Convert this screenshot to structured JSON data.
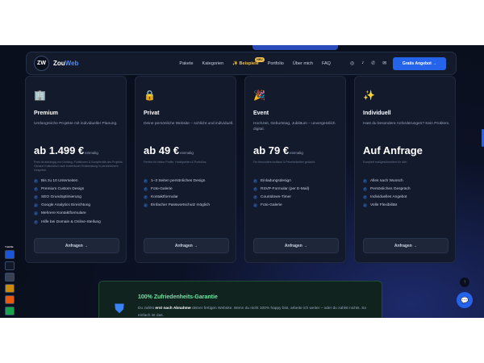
{
  "nav": {
    "logo_text": "ZW",
    "brand_main": "Zou",
    "brand_accent": "Web",
    "links": [
      {
        "label": "Pakete"
      },
      {
        "label": "Kategorien"
      },
      {
        "label": "✨ Beispiele",
        "badge": "NEU"
      },
      {
        "label": "Portfolio"
      },
      {
        "label": "Über mich"
      },
      {
        "label": "FAQ"
      }
    ],
    "icons": [
      "instagram-icon",
      "tiktok-icon",
      "whatsapp-icon",
      "mail-icon"
    ],
    "cta_label": "Gratis Angebot →"
  },
  "cards": [
    {
      "icon": "🏢",
      "title": "Premium",
      "desc": "Umfangreiche Projekte mit individueller Planung.",
      "price": "ab 1.499 €",
      "price_suffix": "einmalig",
      "note": "Preis ist abhängig von Umfang, Funktionen & Komplexität des Projekts. Genaue Kalkulation nach kostenloser Erstberatung in persönlichem Gespräch.",
      "features": [
        "Bis zu 10 Unterseiten",
        "Premium Custom Design",
        "SEO Grundoptimierung",
        "Google Analytics Einrichtung",
        "Mehrere Kontaktformulare",
        "Hilfe bei Domain & Online-Stellung"
      ],
      "button": "Anfragen →"
    },
    {
      "icon": "🔒",
      "title": "Privat",
      "desc": "Deine persönliche Website – schlicht und individuell.",
      "price": "ab 49 €",
      "price_suffix": "einmalig",
      "note": "Perfekt für kleine Profile, Hobbyseiten & Portfolios.",
      "features": [
        "1–3 Seiten persönliches Design",
        "Foto-Galerie",
        "Kontaktformular",
        "Einfacher Passwortschutz möglich"
      ],
      "button": "Anfragen →"
    },
    {
      "icon": "🎉",
      "title": "Event",
      "desc": "Hochzeit, Geburtstag, Jubiläum – unvergesslich digital.",
      "price": "ab 79 €",
      "price_suffix": "einmalig",
      "note": "Für besondere Anlässe & Feierlichkeiten gedacht.",
      "features": [
        "Einladungsdesign",
        "RSVP-Formular (per E-Mail)",
        "Countdown-Timer",
        "Foto-Galerie"
      ],
      "button": "Anfragen →"
    },
    {
      "icon": "✨",
      "title": "Individuell",
      "desc": "Hast du besondere Anforderungen? Kein Problem.",
      "price": "Auf Anfrage",
      "price_suffix": "",
      "note": "Komplett maßgeschneidert für dich.",
      "features": [
        "Alles nach Wunsch",
        "Persönliches Gespräch",
        "Individuelles Angebot",
        "Volle Flexibilität"
      ],
      "button": "Anfragen →"
    }
  ],
  "themes": {
    "label": "THEME",
    "swatches": [
      "#1a56db",
      "#111827",
      "#374151",
      "#ca8a04",
      "#ea580c",
      "#16a34a"
    ]
  },
  "guarantee": {
    "title": "100% Zufriedenheits-Garantie",
    "text_pre": "Du zahlst",
    "text_bold": "erst nach Abnahme",
    "text_post": "deiner fertigen Website. Wenn du nicht 100% happy bist, arbeite ich weiter – oder du zahlst nichts. So einfach ist das."
  },
  "fab": {
    "up": "↑",
    "chat": "💬"
  },
  "colors": {
    "accent": "#2563eb",
    "success": "#6ee7a4",
    "highlight": "#f2c14e"
  }
}
